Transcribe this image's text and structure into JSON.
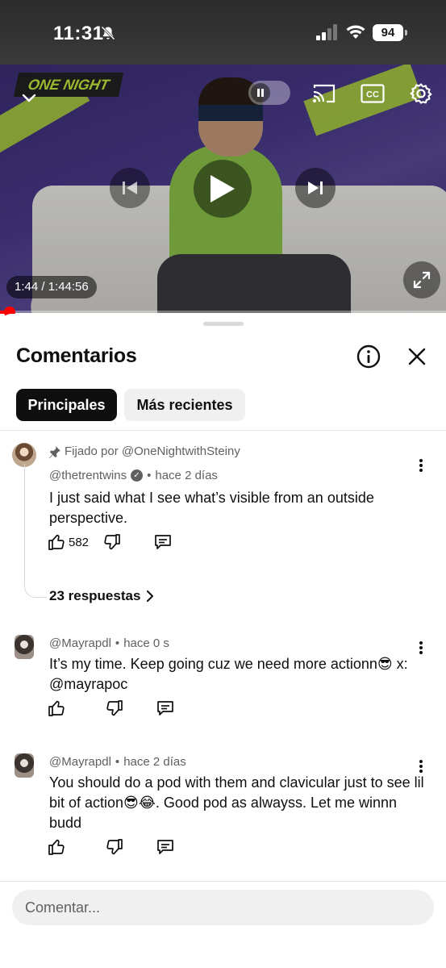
{
  "status_bar": {
    "time": "11:31",
    "battery": "94"
  },
  "player": {
    "time_display": "1:44 / 1:44:56",
    "progress_fraction": 0.0166,
    "channel_logo": "ONE NIGHT"
  },
  "comments_panel": {
    "title": "Comentarios",
    "tabs": [
      {
        "label": "Principales",
        "active": true
      },
      {
        "label": "Más recientes",
        "active": false
      }
    ],
    "comments": [
      {
        "pinned_label": "Fijado por @OneNightwithSteiny",
        "author": "@thetrentwins",
        "verified": true,
        "separator": "•",
        "time": "hace 2 días",
        "text": "I just said what I see what’s visible from an outside perspective.",
        "likes": "582",
        "replies_label": "23 respuestas"
      },
      {
        "author": "@Mayrapdl",
        "separator": "•",
        "time": "hace 0 s",
        "text": "It’s my time. Keep going cuz we need more actionn😎 x: @mayrapoc",
        "likes": ""
      },
      {
        "author": "@Mayrapdl",
        "separator": "•",
        "time": "hace 2 días",
        "text": "You should do a pod with them and clavicular just to see lil bit of action😎😂. Good pod as alwayss. Let me winnn budd",
        "likes": ""
      }
    ],
    "input_placeholder": "Comentar..."
  },
  "colors": {
    "accent_red": "#ff0000",
    "chip_active": "#0f0f0f",
    "chip_inactive": "#f0f0f0",
    "meta_gray": "#606060"
  }
}
